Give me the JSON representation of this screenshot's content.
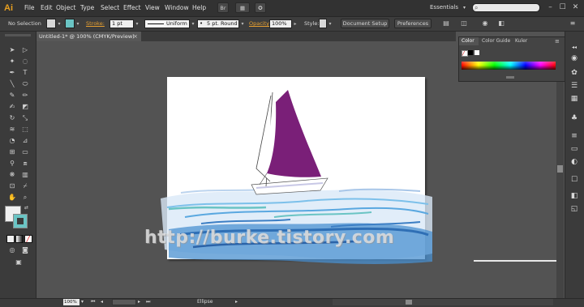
{
  "app": {
    "logo": "Ai"
  },
  "menu": [
    "File",
    "Edit",
    "Object",
    "Type",
    "Select",
    "Effect",
    "View",
    "Window",
    "Help"
  ],
  "menubar_buttons": {
    "bridge": "Br"
  },
  "workspace": {
    "label": "Essentials",
    "search_placeholder": ""
  },
  "control_bar": {
    "selection": "No Selection",
    "stroke_label": "Stroke:",
    "stroke_weight": "1 pt",
    "profile": "Uniform",
    "brush": "5 pt. Round",
    "opacity_label": "Opacity:",
    "opacity_value": "100%",
    "style_label": "Style:",
    "document_setup": "Document Setup",
    "preferences": "Preferences"
  },
  "document_tab": {
    "title": "Untitled-1* @ 100% (CMYK/Preview)",
    "close": "×"
  },
  "color_panel": {
    "tabs": [
      "Color",
      "Color Guide",
      "Kuler"
    ]
  },
  "artwork": {
    "watermark": "http://burke.tistory.com"
  },
  "status_bar": {
    "zoom": "100%",
    "tool": "Ellipse"
  },
  "colors": {
    "accent": "#e8a030",
    "sail": "#7a1f78",
    "stroke_swatch": "#6ac4c4"
  },
  "tools": [
    "selection-icon",
    "direct-selection-icon",
    "magic-wand-icon",
    "lasso-icon",
    "pen-icon",
    "type-icon",
    "line-icon",
    "ellipse-icon",
    "paintbrush-icon",
    "pencil-icon",
    "blob-brush-icon",
    "eraser-icon",
    "rotate-icon",
    "scale-icon",
    "width-icon",
    "free-transform-icon",
    "shape-builder-icon",
    "perspective-icon",
    "mesh-icon",
    "gradient-icon",
    "eyedropper-icon",
    "blend-icon",
    "symbol-sprayer-icon",
    "graph-icon",
    "artboard-icon",
    "slice-icon",
    "hand-icon",
    "zoom-icon"
  ]
}
